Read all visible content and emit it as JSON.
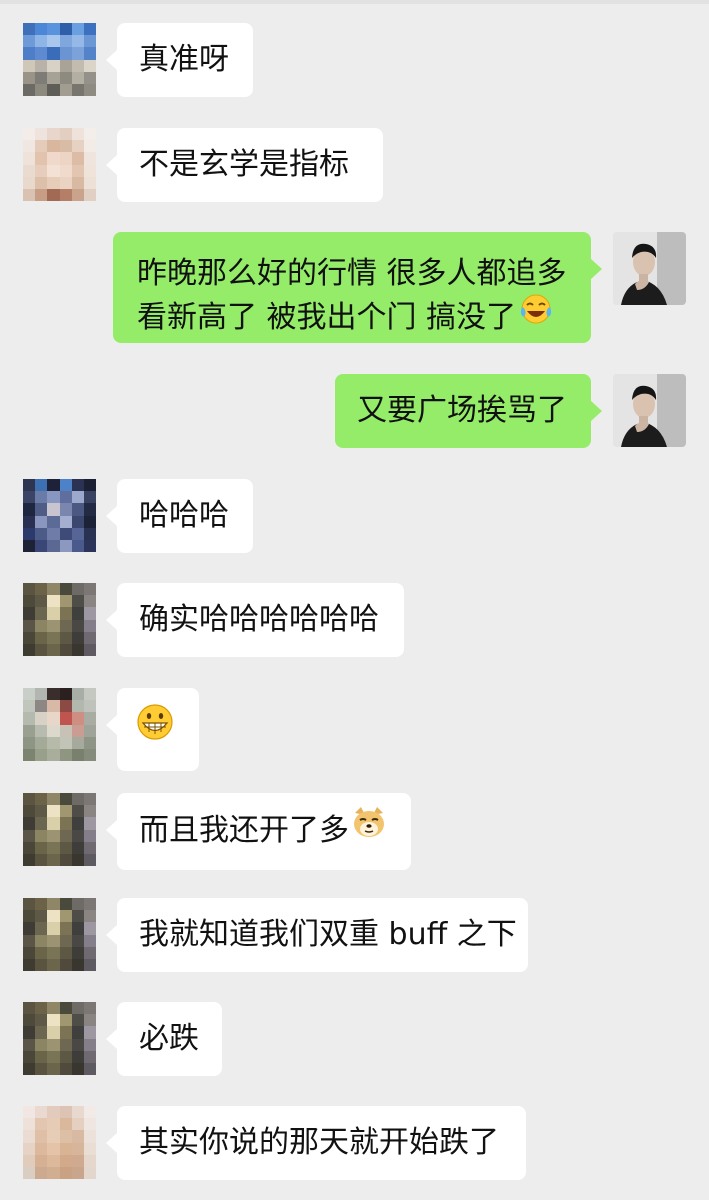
{
  "messages": [
    {
      "id": "m1",
      "direction": "in",
      "text": "真准呀",
      "emoji": ""
    },
    {
      "id": "m2",
      "direction": "in",
      "text": "不是玄学是指标",
      "emoji": ""
    },
    {
      "id": "m3",
      "direction": "out",
      "text": "昨晚那么好的行情 很多人都追多看新高了 被我出个门 搞没了",
      "emoji": "crying-laughing-face"
    },
    {
      "id": "m4",
      "direction": "out",
      "text": "又要广场挨骂了",
      "emoji": ""
    },
    {
      "id": "m5",
      "direction": "in",
      "text": "哈哈哈",
      "emoji": ""
    },
    {
      "id": "m6",
      "direction": "in",
      "text": "确实哈哈哈哈哈哈",
      "emoji": ""
    },
    {
      "id": "m7",
      "direction": "in",
      "text": "",
      "emoji": "grinning-face"
    },
    {
      "id": "m8",
      "direction": "in",
      "text": "而且我还开了多",
      "emoji": "doge-face"
    },
    {
      "id": "m9",
      "direction": "in",
      "text": "我就知道我们双重 buff 之下",
      "emoji": ""
    },
    {
      "id": "m10",
      "direction": "in",
      "text": "必跌",
      "emoji": ""
    },
    {
      "id": "m11",
      "direction": "in",
      "text": "其实你说的那天就开始跌了",
      "emoji": ""
    }
  ],
  "colors": {
    "background": "#EDEDED",
    "incoming_bubble": "#FFFFFF",
    "outgoing_bubble": "#95EC69",
    "text": "#111111"
  }
}
